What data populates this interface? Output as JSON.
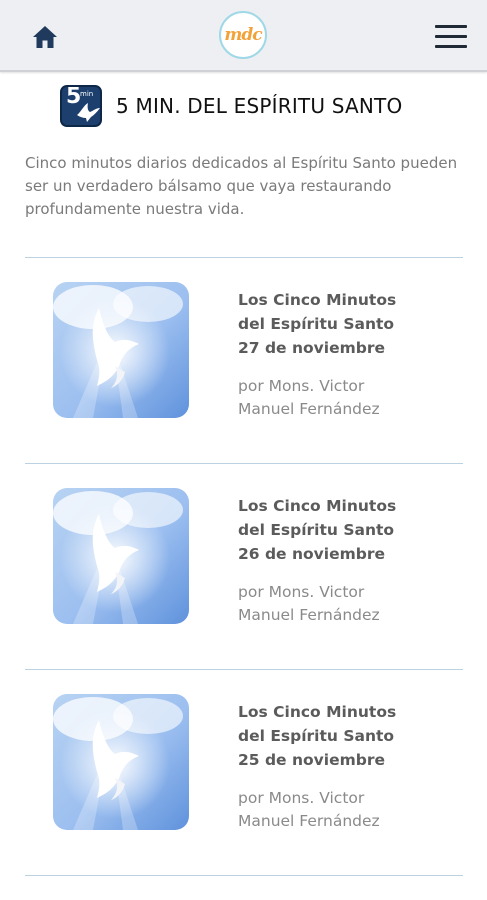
{
  "header": {
    "logo_text": "mdc",
    "icons": {
      "home": "home-icon",
      "menu": "hamburger-menu-icon"
    },
    "colors": {
      "bar": "#eeeff3",
      "logo_ring": "#9fd8e6",
      "logo_text": "#f2a23a"
    }
  },
  "section": {
    "icon_number": "5",
    "icon_caption": "min",
    "title": "5 MIN. DEL ESPÍRITU SANTO",
    "description": "Cinco minutos diarios dedicados al Espíritu Santo pueden ser un verdadero bálsamo que vaya restaurando profundamente nuestra vida."
  },
  "posts": [
    {
      "title_line1": "Los Cinco Minutos",
      "title_line2": "del Espíritu Santo",
      "date": "27 de noviembre",
      "author_line1": "por Mons. Victor",
      "author_line2": "Manuel Fernández",
      "thumbnail": "dove-in-clouds-image"
    },
    {
      "title_line1": "Los Cinco Minutos",
      "title_line2": "del Espíritu Santo",
      "date": "26 de noviembre",
      "author_line1": "por Mons. Victor",
      "author_line2": "Manuel Fernández",
      "thumbnail": "dove-in-clouds-image"
    },
    {
      "title_line1": "Los Cinco Minutos",
      "title_line2": "del Espíritu Santo",
      "date": "25 de noviembre",
      "author_line1": "por Mons. Victor",
      "author_line2": "Manuel Fernández",
      "thumbnail": "dove-in-clouds-image"
    }
  ]
}
